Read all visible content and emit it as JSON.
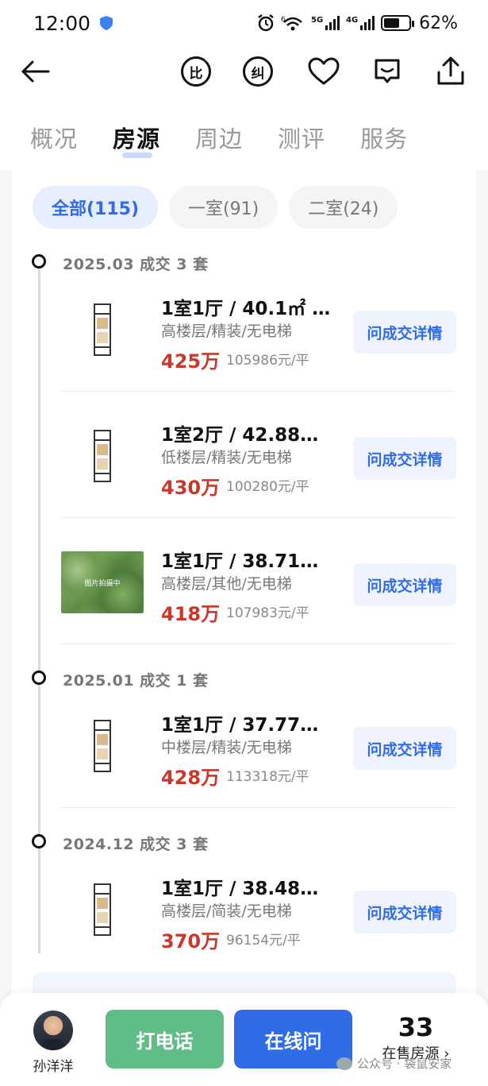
{
  "status_bar": {
    "time": "12:00",
    "signal_5g": "5G",
    "signal_4g": "4G",
    "wifi_label": "6",
    "battery": "62%",
    "battery_level": 0.62
  },
  "toolbar": {
    "compare_label": "比",
    "correct_label": "纠"
  },
  "tabs": [
    {
      "label": "概况"
    },
    {
      "label": "房源"
    },
    {
      "label": "周边"
    },
    {
      "label": "测评"
    },
    {
      "label": "服务"
    }
  ],
  "active_tab": "房源",
  "filters": [
    {
      "label": "全部(115)"
    },
    {
      "label": "一室(91)"
    },
    {
      "label": "二室(24)"
    }
  ],
  "groups": [
    {
      "title": "2025.03 成交 3 套"
    },
    {
      "title": "2025.01 成交 1 套"
    },
    {
      "title": "2024.12 成交 3 套"
    }
  ],
  "listings": [
    {
      "title": "1室1厅 / 40.1㎡ / ...",
      "sub": "高楼层/精装/无电梯",
      "price": "425万",
      "unit_price": "105986元/平",
      "button": "问成交详情",
      "thumb": "floorplan"
    },
    {
      "title": "1室2厅 / 42.88㎡ ...",
      "sub": "低楼层/精装/无电梯",
      "price": "430万",
      "unit_price": "100280元/平",
      "button": "问成交详情",
      "thumb": "floorplan"
    },
    {
      "title": "1室1厅 / 38.71㎡ ...",
      "sub": "高楼层/其他/无电梯",
      "price": "418万",
      "unit_price": "107983元/平",
      "button": "问成交详情",
      "thumb": "photo",
      "thumb_caption": "图片拍摄中"
    },
    {
      "title": "1室1厅 / 37.77㎡ ...",
      "sub": "中楼层/精装/无电梯",
      "price": "428万",
      "unit_price": "113318元/平",
      "button": "问成交详情",
      "thumb": "floorplan"
    },
    {
      "title": "1室1厅 / 38.48㎡ ...",
      "sub": "高楼层/简装/无电梯",
      "price": "370万",
      "unit_price": "96154元/平",
      "button": "问成交详情",
      "thumb": "floorplan"
    }
  ],
  "bottom_bar": {
    "agent_name": "孙洋洋",
    "call_label": "打电话",
    "chat_label": "在线问",
    "onsale_count": "33",
    "onsale_label": "在售房源 ›"
  },
  "watermark": "公众号 · 袋鼠安家",
  "colors": {
    "accent_blue": "#2f6ce5",
    "price_red": "#c8392b",
    "call_green": "#5fbd87"
  }
}
